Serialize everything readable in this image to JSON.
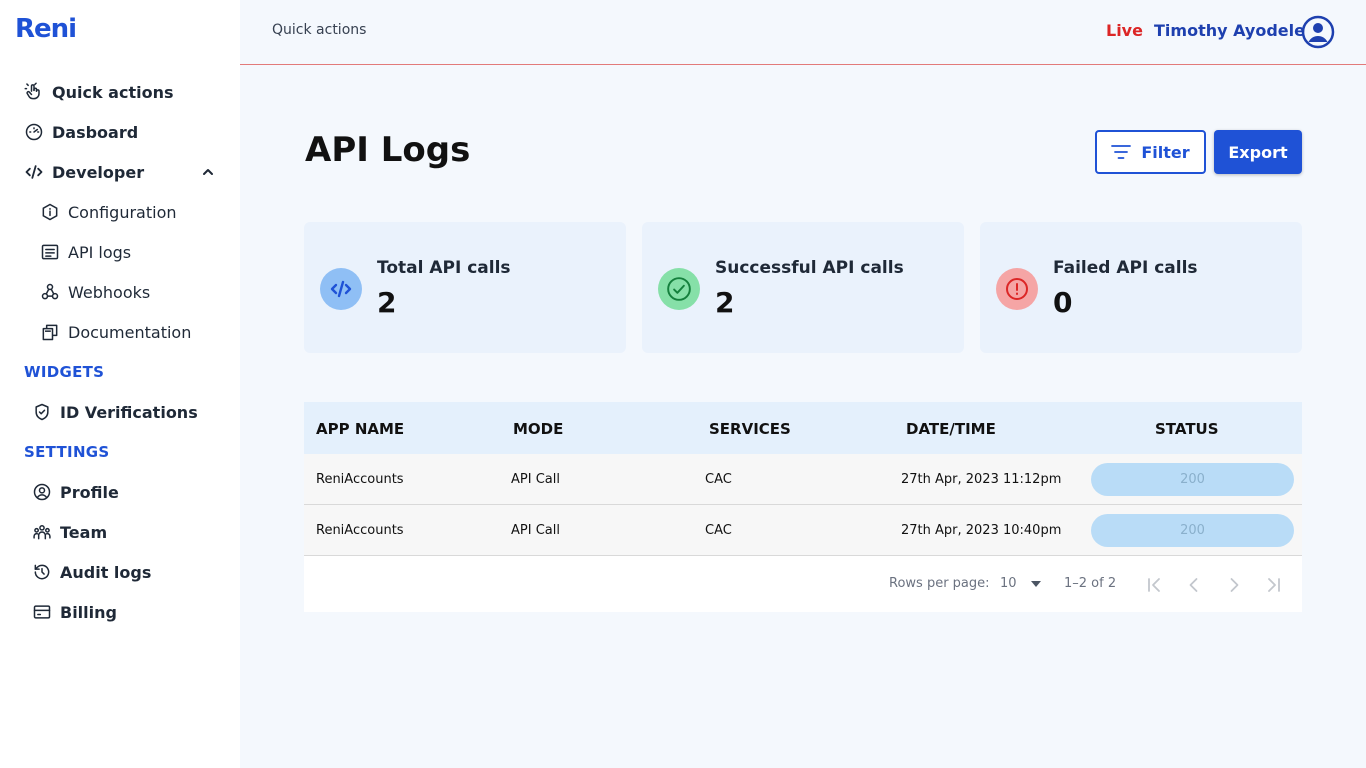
{
  "app": {
    "logo": "Reni"
  },
  "sidebar": {
    "items": [
      {
        "label": "Quick actions",
        "icon": "pointer-hand-icon"
      },
      {
        "label": "Dasboard",
        "icon": "gauge-icon"
      },
      {
        "label": "Developer",
        "icon": "code-icon"
      }
    ],
    "developer_sub": [
      {
        "label": "Configuration",
        "icon": "info-hexagon-icon"
      },
      {
        "label": "API logs",
        "icon": "document-list-icon"
      },
      {
        "label": "Webhooks",
        "icon": "webhook-icon"
      },
      {
        "label": "Documentation",
        "icon": "copy-pages-icon"
      }
    ],
    "widgets_title": "WIDGETS",
    "widgets": [
      {
        "label": "ID Verifications",
        "icon": "shield-check-icon"
      }
    ],
    "settings_title": "SETTINGS",
    "settings": [
      {
        "label": "Profile",
        "icon": "user-circle-icon"
      },
      {
        "label": "Team",
        "icon": "team-icon"
      },
      {
        "label": "Audit logs",
        "icon": "history-icon"
      },
      {
        "label": "Billing",
        "icon": "credit-card-icon"
      }
    ]
  },
  "header": {
    "breadcrumb": "Quick actions",
    "mode": "Live",
    "user_name": "Timothy Ayodele"
  },
  "main": {
    "title": "API Logs",
    "filter_label": "Filter",
    "export_label": "Export",
    "stats": [
      {
        "label": "Total API calls",
        "value": "2",
        "icon": "code-icon",
        "color": "#8fbff5",
        "icon_color": "#1f52d6"
      },
      {
        "label": "Successful API calls",
        "value": "2",
        "icon": "check-circle-icon",
        "color": "#86e0a8",
        "icon_color": "#15803d"
      },
      {
        "label": "Failed API calls",
        "value": "0",
        "icon": "alert-circle-icon",
        "color": "#f5a5a5",
        "icon_color": "#dc2626"
      }
    ],
    "table": {
      "columns": [
        "APP NAME",
        "MODE",
        "SERVICES",
        "DATE/TIME",
        "STATUS"
      ],
      "rows": [
        {
          "app_name": "ReniAccounts",
          "mode": "API Call",
          "services": "CAC",
          "datetime": "27th Apr, 2023 11:12pm",
          "status": "200"
        },
        {
          "app_name": "ReniAccounts",
          "mode": "API Call",
          "services": "CAC",
          "datetime": "27th Apr, 2023 10:40pm",
          "status": "200"
        }
      ],
      "rows_per_page_label": "Rows per page:",
      "rows_per_page": "10",
      "range": "1–2 of 2"
    }
  },
  "colors": {
    "brand": "#1f52d6",
    "live": "#dc2626",
    "divider": "#e27a7a"
  }
}
